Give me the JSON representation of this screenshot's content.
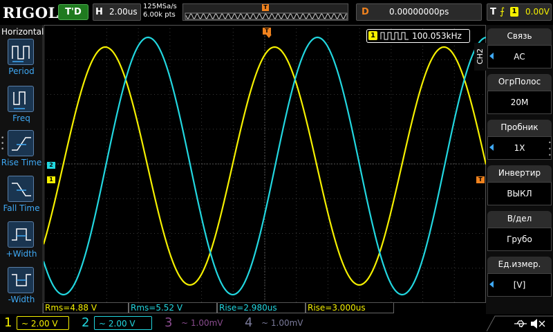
{
  "topbar": {
    "logo": "RIGOL",
    "run_state": "T'D",
    "timebase_key": "H",
    "timebase_value": "2.00us",
    "sample_rate": "125MSa/s",
    "memory_depth": "6.00k pts",
    "trigger_pos_marker": "T",
    "delay_key": "D",
    "delay_value": "0.00000000ps",
    "trig_key": "T",
    "trig_edge_glyph": "⨍",
    "trig_source": "1",
    "trig_level": "0.00V"
  },
  "left_panel": {
    "title": "Horizontal",
    "items": [
      {
        "label": "Period",
        "icon": "period-icon"
      },
      {
        "label": "Freq",
        "icon": "frequency-icon"
      },
      {
        "label": "Rise Time",
        "icon": "rise-time-icon"
      },
      {
        "label": "Fall Time",
        "icon": "fall-time-icon"
      },
      {
        "label": "+Width",
        "icon": "positive-width-icon"
      },
      {
        "label": "-Width",
        "icon": "negative-width-icon"
      }
    ]
  },
  "plot": {
    "trigger_marker": "T",
    "ch1_marker": "1",
    "ch2_marker": "2",
    "trig_level_marker": "T",
    "freq_channel": "1",
    "freq_value": "100.053kHz"
  },
  "results": [
    {
      "text": "Rms=4.88 V",
      "channel": 1
    },
    {
      "text": "Rms=5.52 V",
      "channel": 2
    },
    {
      "text": "Rise=2.980us",
      "channel": 2
    },
    {
      "text": "Rise=3.000us",
      "channel": 1
    }
  ],
  "right_menu": {
    "channel_tab": "CH2",
    "items": [
      {
        "label": "Связь",
        "value": "AC",
        "arrow": true
      },
      {
        "label": "ОгрПолос",
        "value": "20M",
        "arrow": false
      },
      {
        "label": "Пробник",
        "value": "1X",
        "arrow": true
      },
      {
        "label": "Инвертир",
        "value": "ВЫКЛ",
        "arrow": false
      },
      {
        "label": "В/дел",
        "value": "Грубо",
        "arrow": false
      },
      {
        "label": "Ед.измер.",
        "value": "[V]",
        "arrow": true
      }
    ]
  },
  "bottombar": {
    "channels": [
      {
        "num": "1",
        "scale": "~ 2.00 V",
        "active": true
      },
      {
        "num": "2",
        "scale": "~ 2.00 V",
        "active": true
      },
      {
        "num": "3",
        "scale": "~ 1.00mV",
        "active": false
      },
      {
        "num": "4",
        "scale": "~ 1.00mV",
        "active": false
      }
    ]
  },
  "colors": {
    "ch1": "#f5f000",
    "ch2": "#22d7e0",
    "trigger": "#f0821e",
    "accent": "#3fa9f5"
  }
}
